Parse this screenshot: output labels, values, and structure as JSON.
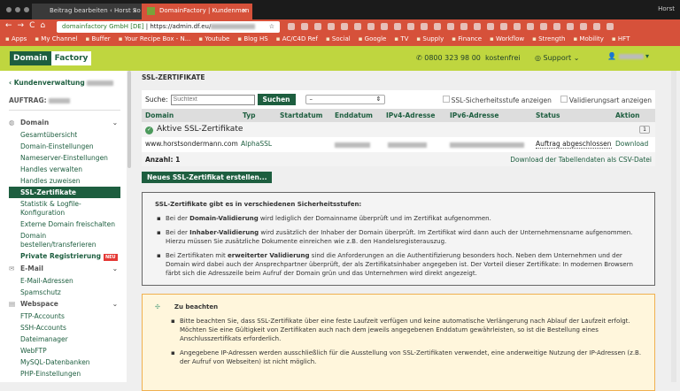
{
  "browser": {
    "tabs": [
      "Beitrag bearbeiten ‹ Horst So",
      "DomainFactory | Kundenmen"
    ],
    "user": "Horst",
    "site_label": "domainfactory GmbH [DE]",
    "url": "https://admin.df.eu/",
    "bookmarks": [
      "Apps",
      "My Channel",
      "Buffer",
      "Your Recipe Box - N...",
      "Youtube",
      "Blog HS",
      "AC/C4D Ref",
      "Social",
      "Google",
      "TV",
      "Supply",
      "Finance",
      "Workflow",
      "Strength",
      "Mobility",
      "HFT"
    ]
  },
  "header": {
    "logo_a": "Domain",
    "logo_b": "Factory",
    "phone": "0800 323 98 00",
    "phone_note": "kostenfrei",
    "support": "Support"
  },
  "sidebar": {
    "back": "‹ Kundenverwaltung",
    "auftrag": "AUFTRAG:",
    "domain": "Domain",
    "domain_items": [
      "Gesamtübersicht",
      "Domain-Einstellungen",
      "Nameserver-Einstellungen",
      "Handles verwalten",
      "Handles zuweisen",
      "SSL-Zertifikate",
      "Statistik & Logfile-Konfiguration",
      "Externe Domain freischalten",
      "Domain bestellen/transferieren",
      "Private Registrierung"
    ],
    "neu": "NEU",
    "email": "E-Mail",
    "email_items": [
      "E-Mail-Adressen",
      "Spamschutz"
    ],
    "webspace": "Webspace",
    "webspace_items": [
      "FTP-Accounts",
      "SSH-Accounts",
      "Dateimanager",
      "WebFTP",
      "MySQL-Datenbanken",
      "PHP-Einstellungen"
    ]
  },
  "main": {
    "title": "SSL-ZERTIFIKATE",
    "search_label": "Suche:",
    "search_placeholder": "Suchtext",
    "search_btn": "Suchen",
    "filter": "–",
    "chk1": "SSL-Sicherheitsstufe anzeigen",
    "chk2": "Validierungsart anzeigen",
    "columns": [
      "Domain",
      "Typ",
      "Startdatum",
      "Enddatum",
      "IPv4-Adresse",
      "IPv6-Adresse",
      "Status",
      "Aktion"
    ],
    "group": "Aktive SSL-Zertifikate",
    "group_count": "1",
    "row": {
      "domain": "www.horstsondermann.com",
      "typ": "AlphaSSL",
      "status": "Auftrag abgeschlossen",
      "aktion": "Download"
    },
    "count": "Anzahl: 1",
    "csv": "Download der Tabellendaten als CSV-Datei",
    "new_btn": "Neues SSL-Zertifikat erstellen...",
    "info_title": "SSL-Zertifikate gibt es in verschiedenen Sicherheitsstufen:",
    "info": [
      {
        "pre": "Bei der ",
        "b": "Domain-Validierung",
        "post": " wird lediglich der Domainname überprüft und im Zertifikat aufgenommen."
      },
      {
        "pre": "Bei der ",
        "b": "Inhaber-Validierung",
        "post": " wird zusätzlich der Inhaber der Domain überprüft. Im Zertifikat wird dann auch der Unternehmensname aufgenommen. Hierzu müssen Sie zusätzliche Dokumente einreichen wie z.B. den Handelsregisterauszug."
      },
      {
        "pre": "Bei Zertifikaten mit ",
        "b": "erweiterter Validierung",
        "post": " sind die Anforderungen an die Authentifizierung besonders hoch. Neben dem Unternehmen und der Domain wird dabei auch der Ansprechpartner überprüft, der als Zertifikatsinhaber angegeben ist. Der Vorteil dieser Zertifikate: In modernen Browsern färbt sich die Adresszeile beim Aufruf der Domain grün und das Unternehmen wird direkt angezeigt."
      }
    ],
    "warn_title": "Zu beachten",
    "warn": [
      "Bitte beachten Sie, dass SSL-Zertifikate über eine feste Laufzeit verfügen und keine automatische Verlängerung nach Ablauf der Laufzeit erfolgt. Möchten Sie eine Gültigkeit von Zertifikaten auch nach dem jeweils angegebenen Enddatum gewährleisten, so ist die Bestellung eines Anschlusszertifikats erforderlich.",
      "Angegebene IP-Adressen werden ausschließlich für die Ausstellung von SSL-Zertifikaten verwendet, eine anderweitige Nutzung der IP-Adressen (z.B. der Aufruf von Webseiten) ist nicht möglich."
    ]
  }
}
